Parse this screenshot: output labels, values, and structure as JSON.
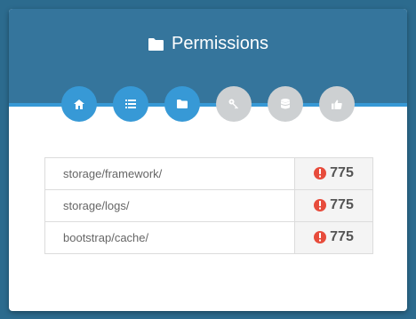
{
  "header": {
    "title": "Permissions",
    "icon": "folder-icon"
  },
  "steps": [
    {
      "name": "home-icon",
      "state": "done"
    },
    {
      "name": "list-icon",
      "state": "done"
    },
    {
      "name": "folder-icon",
      "state": "done"
    },
    {
      "name": "key-icon",
      "state": "todo"
    },
    {
      "name": "database-icon",
      "state": "todo"
    },
    {
      "name": "thumbs-up-icon",
      "state": "todo"
    }
  ],
  "permissions": [
    {
      "path": "storage/framework/",
      "value": "775",
      "status": "error"
    },
    {
      "path": "storage/logs/",
      "value": "775",
      "status": "error"
    },
    {
      "path": "bootstrap/cache/",
      "value": "775",
      "status": "error"
    }
  ],
  "colors": {
    "header": "#35759c",
    "accent": "#3799d6",
    "inactive": "#cdd0d2",
    "error": "#e74c3c"
  }
}
